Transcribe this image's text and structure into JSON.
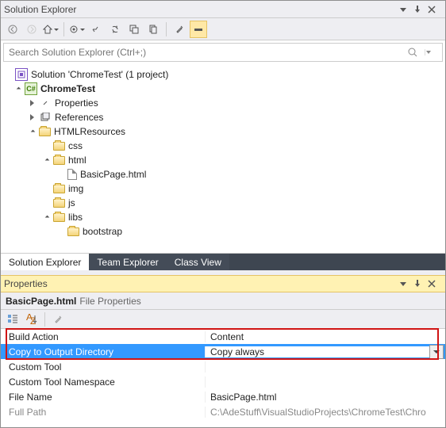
{
  "solutionExplorer": {
    "title": "Solution Explorer",
    "searchPlaceholder": "Search Solution Explorer (Ctrl+;)",
    "solutionLabel": "Solution 'ChromeTest' (1 project)",
    "project": "ChromeTest",
    "properties": "Properties",
    "references": "References",
    "htmlResources": "HTMLResources",
    "folders": {
      "css": "css",
      "html": "html",
      "img": "img",
      "js": "js",
      "libs": "libs",
      "bootstrap": "bootstrap"
    },
    "file": "BasicPage.html",
    "tabs": {
      "solution": "Solution Explorer",
      "team": "Team Explorer",
      "class": "Class View"
    }
  },
  "propertiesPanel": {
    "title": "Properties",
    "objectName": "BasicPage.html",
    "objectType": "File Properties",
    "rows": {
      "buildAction": {
        "k": "Build Action",
        "v": "Content"
      },
      "copyOut": {
        "k": "Copy to Output Directory",
        "v": "Copy always"
      },
      "customTool": {
        "k": "Custom Tool",
        "v": ""
      },
      "customNs": {
        "k": "Custom Tool Namespace",
        "v": ""
      },
      "fileName": {
        "k": "File Name",
        "v": "BasicPage.html"
      },
      "fullPath": {
        "k": "Full Path",
        "v": "C:\\AdeStuff\\VisualStudioProjects\\ChromeTest\\Chro"
      }
    }
  }
}
